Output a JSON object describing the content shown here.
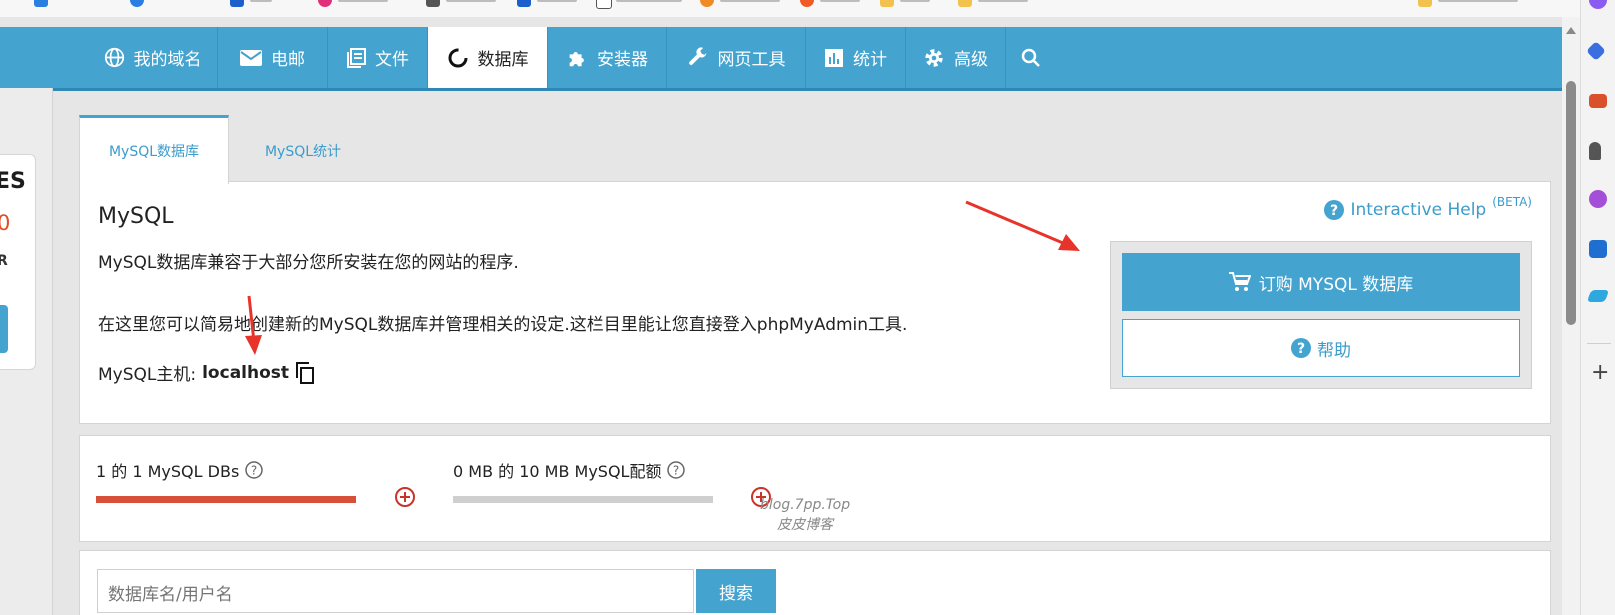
{
  "nav": {
    "items": [
      {
        "label": "我的域名",
        "icon": "globe-icon"
      },
      {
        "label": "电邮",
        "icon": "mail-icon"
      },
      {
        "label": "文件",
        "icon": "files-icon"
      },
      {
        "label": "数据库",
        "icon": "database-icon",
        "active": true
      },
      {
        "label": "安装器",
        "icon": "puzzle-icon"
      },
      {
        "label": "网页工具",
        "icon": "wrench-icon"
      },
      {
        "label": "统计",
        "icon": "chart-icon"
      },
      {
        "label": "高级",
        "icon": "gear-icon"
      }
    ],
    "search_icon": "search-icon"
  },
  "sidebar": {
    "card_line1": "ES",
    "card_line2": "0",
    "card_line3": "R"
  },
  "tabs": [
    {
      "label": "MySQL数据库",
      "active": true
    },
    {
      "label": "MySQL统计",
      "active": false
    }
  ],
  "panel": {
    "title": "MySQL",
    "help_link": "Interactive Help",
    "help_beta": "(BETA)",
    "desc1": "MySQL数据库兼容于大部分您所安装在您的网站的程序.",
    "desc2": "在这里您可以简易地创建新的MySQL数据库并管理相关的设定.这栏目里能让您直接登入phpMyAdmin工具.",
    "host_label": "MySQL主机:",
    "host_value": "localhost",
    "order_button": "订购 MYSQL 数据库",
    "help_button": "帮助"
  },
  "stats": {
    "db_label": "1 的 1 MySQL DBs",
    "db_fraction": 1.0,
    "quota_label": "0 MB 的 10 MB MySQL配额",
    "quota_fraction": 0.0
  },
  "search": {
    "placeholder": "数据库名/用户名",
    "button": "搜索"
  },
  "watermark": {
    "line1": "blog.7pp.Top",
    "line2": "皮皮博客"
  },
  "colors": {
    "primary": "#44a3cf",
    "danger": "#d6503a",
    "annotation_arrow": "#e8332a"
  }
}
